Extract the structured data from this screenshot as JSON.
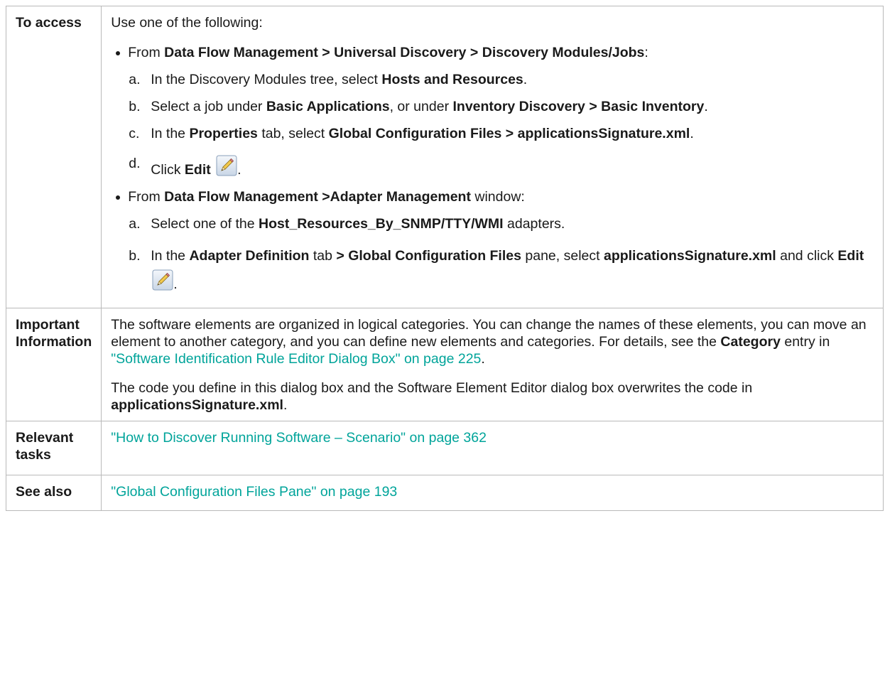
{
  "rows": [
    {
      "label": "To access",
      "lead": "Use one of the following:",
      "bullet1": {
        "pre": "From ",
        "bold": "Data Flow Management > Universal Discovery > Discovery Modules/Jobs",
        "post": ":",
        "items": [
          {
            "letter": "a.",
            "t1": "In the Discovery Modules tree, select ",
            "b1": "Hosts and Resources",
            "t2": "."
          },
          {
            "letter": "b.",
            "t1": "Select a job under ",
            "b1": "Basic Applications",
            "t2": ", or under ",
            "b2": "Inventory Discovery > Basic Inventory",
            "t3": "."
          },
          {
            "letter": "c.",
            "t1": "In the ",
            "b1": "Properties",
            "t2": " tab, select ",
            "b2": "Global Configuration Files > applicationsSignature.xml",
            "t3": "."
          },
          {
            "letter": "d.",
            "t1": "Click ",
            "b1": "Edit",
            "t2": "."
          }
        ]
      },
      "bullet2": {
        "pre": "From ",
        "bold": "Data Flow Management >Adapter Management",
        "post": " window:",
        "items": [
          {
            "letter": "a.",
            "t1": "Select one of the ",
            "b1": "Host_Resources_By_SNMP/TTY/WMI",
            "t2": " adapters."
          },
          {
            "letter": "b.",
            "t1": "In the ",
            "b1": "Adapter Definition",
            "t2": " tab ",
            "b2": "> Global Configuration Files",
            "t3": " pane, select ",
            "b3": "applicationsSignature.xml",
            "t4": " and click ",
            "b4": "Edit",
            "t5": "."
          }
        ]
      }
    },
    {
      "label": "Important Information",
      "p1_t1": "The software elements are organized in logical categories. You can change the names of these elements, you can move an element to another category, and you can define new elements and categories. For details, see the ",
      "p1_b1": "Category",
      "p1_t2": " entry in ",
      "p1_link": "\"Software Identification Rule Editor Dialog Box\" on page 225",
      "p1_t3": ".",
      "p2_t1": "The code you define in this dialog box and the Software Element Editor dialog box overwrites the code in ",
      "p2_b1": "applicationsSignature.xml",
      "p2_t2": "."
    },
    {
      "label": "Relevant tasks",
      "link": "\"How to Discover Running Software – Scenario\" on page 362"
    },
    {
      "label": "See also",
      "link": "\"Global Configuration Files Pane\" on page 193"
    }
  ],
  "colors": {
    "link": "#00a49a",
    "border": "#b9b9b9",
    "text": "#1a1a1a"
  },
  "icons": {
    "edit": "pencil-edit-icon"
  }
}
